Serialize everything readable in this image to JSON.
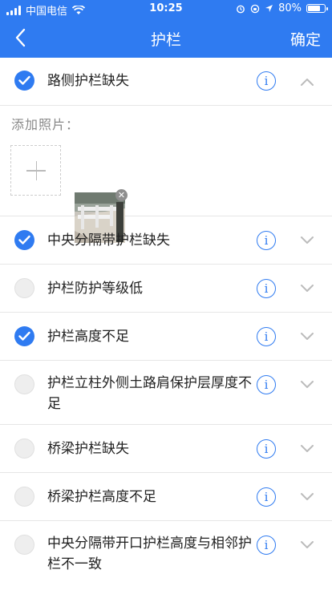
{
  "status_bar": {
    "carrier": "中国电信",
    "time": "10:25",
    "battery": "80%",
    "battery_level": 0.8
  },
  "nav": {
    "title": "护栏",
    "confirm_label": "确定"
  },
  "photo": {
    "label": "添加照片："
  },
  "items": [
    {
      "label": "路侧护栏缺失",
      "checked": true,
      "expanded": true
    },
    {
      "label": "中央分隔带护栏缺失",
      "checked": true,
      "expanded": false
    },
    {
      "label": "护栏防护等级低",
      "checked": false,
      "expanded": false
    },
    {
      "label": "护栏高度不足",
      "checked": true,
      "expanded": false
    },
    {
      "label": "护栏立柱外侧土路肩保护层厚度不足",
      "checked": false,
      "expanded": false
    },
    {
      "label": "桥梁护栏缺失",
      "checked": false,
      "expanded": false
    },
    {
      "label": "桥梁护栏高度不足",
      "checked": false,
      "expanded": false
    },
    {
      "label": "中央分隔带开口护栏高度与相邻护栏不一致",
      "checked": false,
      "expanded": false
    }
  ],
  "colors": {
    "accent": "#2f7bf1",
    "divider": "#e6e6e6"
  },
  "icons": {
    "info": "info-icon",
    "chevron_up": "chevron-up-icon",
    "chevron_down": "chevron-down-icon",
    "add": "add-photo-icon",
    "remove": "remove-photo-icon"
  }
}
